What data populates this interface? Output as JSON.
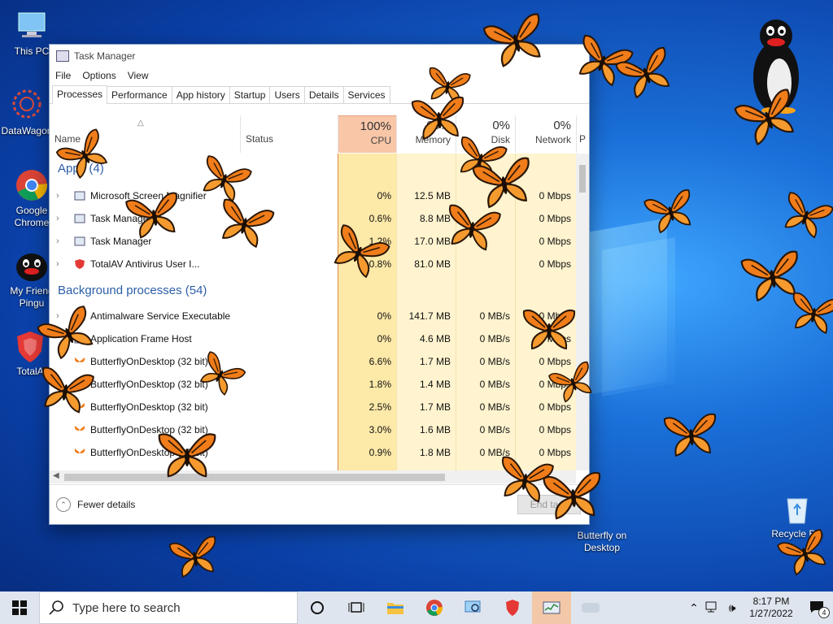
{
  "desktop": {
    "icons": [
      {
        "label": "This PC",
        "icon": "pc-icon"
      },
      {
        "label": "DataWagon",
        "icon": "datawagon-icon"
      },
      {
        "label": "Google Chrome",
        "icon": "chrome-icon"
      },
      {
        "label": "My Friend Pingu",
        "icon": "pingu-icon"
      },
      {
        "label": "TotalA",
        "icon": "totalav-icon"
      },
      {
        "label": "Recycle Bin",
        "icon": "recycle-bin-icon"
      },
      {
        "label": "Butterfly on Desktop",
        "icon": "butterfly-icon"
      }
    ]
  },
  "task_manager": {
    "title": "Task Manager",
    "menu": [
      "File",
      "Options",
      "View"
    ],
    "tabs": [
      "Processes",
      "Performance",
      "App history",
      "Startup",
      "Users",
      "Details",
      "Services"
    ],
    "active_tab": "Processes",
    "columns": {
      "name": "Name",
      "status": "Status",
      "cpu_pct": "100%",
      "cpu": "CPU",
      "memory_pct": "60%",
      "memory": "Memory",
      "disk_pct": "0%",
      "disk": "Disk",
      "network_pct": "0%",
      "network": "Network",
      "power": "P"
    },
    "apps_group": "Apps (4)",
    "apps": [
      {
        "name": "Microsoft Screen Magnifier",
        "cpu": "0%",
        "memory": "12.5 MB",
        "disk": "",
        "network": "0 Mbps"
      },
      {
        "name": "Task Manager",
        "cpu": "0.6%",
        "memory": "8.8 MB",
        "disk": "",
        "network": "0 Mbps"
      },
      {
        "name": "Task Manager",
        "cpu": "1.2%",
        "memory": "17.0 MB",
        "disk": "",
        "network": "0 Mbps"
      },
      {
        "name": "TotalAV Antivirus User I...",
        "cpu": "0.8%",
        "memory": "81.0 MB",
        "disk": "",
        "network": "0 Mbps"
      }
    ],
    "bg_group": "Background processes (54)",
    "background": [
      {
        "name": "Antimalware Service Executable",
        "cpu": "0%",
        "memory": "141.7 MB",
        "disk": "0 MB/s",
        "network": "0 Mbps"
      },
      {
        "name": "Application Frame Host",
        "cpu": "0%",
        "memory": "4.6 MB",
        "disk": "0 MB/s",
        "network": "0 Mbps"
      },
      {
        "name": "ButterflyOnDesktop (32 bit)",
        "cpu": "6.6%",
        "memory": "1.7 MB",
        "disk": "0 MB/s",
        "network": "0 Mbps"
      },
      {
        "name": "ButterflyOnDesktop (32 bit)",
        "cpu": "1.8%",
        "memory": "1.4 MB",
        "disk": "0 MB/s",
        "network": "0 Mbps"
      },
      {
        "name": "ButterflyOnDesktop (32 bit)",
        "cpu": "2.5%",
        "memory": "1.7 MB",
        "disk": "0 MB/s",
        "network": "0 Mbps"
      },
      {
        "name": "ButterflyOnDesktop (32 bit)",
        "cpu": "3.0%",
        "memory": "1.6 MB",
        "disk": "0 MB/s",
        "network": "0 Mbps"
      },
      {
        "name": "ButterflyOnDesktop (32 bit)",
        "cpu": "0.9%",
        "memory": "1.8 MB",
        "disk": "0 MB/s",
        "network": "0 Mbps"
      }
    ],
    "fewer_details": "Fewer details",
    "end_task": "End task"
  },
  "taskbar": {
    "search_placeholder": "Type here to search",
    "time": "8:17 PM",
    "date": "1/27/2022",
    "notification_count": "4"
  },
  "colors": {
    "accent": "#0a3fa6",
    "cpu_header": "#f9c6a8",
    "heat_light": "#fff4cf",
    "heat_mid": "#fde9a8",
    "butterfly": "#f07d1a"
  }
}
